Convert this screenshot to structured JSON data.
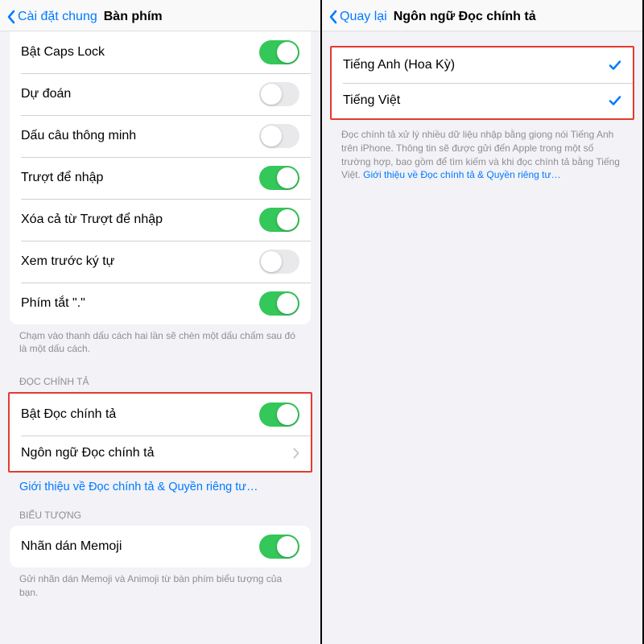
{
  "left": {
    "nav": {
      "back": "Cài đặt chung",
      "title": "Bàn phím"
    },
    "rows": {
      "capslock": "Bật Caps Lock",
      "prediction": "Dự đoán",
      "smart_punctuation": "Dấu câu thông minh",
      "slide_to_type": "Trượt để nhập",
      "delete_slide": "Xóa cả từ Trượt để nhập",
      "char_preview": "Xem trước ký tự",
      "period_shortcut": "Phím tắt \".\""
    },
    "footer1": "Chạm vào thanh dấu cách hai lần sẽ chèn một dấu chấm sau đó là một dấu cách.",
    "section_dictation": "ĐỌC CHÍNH TẢ",
    "dictation_enable": "Bật Đọc chính tả",
    "dictation_langs": "Ngôn ngữ Đọc chính tả",
    "dictation_link": "Giới thiệu về Đọc chính tả & Quyền riêng tư…",
    "section_emoji": "BIỂU TƯỢNG",
    "memoji": "Nhãn dán Memoji",
    "footer2": "Gửi nhãn dán Memoji và Animoji từ bàn phím biểu tượng của bạn."
  },
  "right": {
    "nav": {
      "back": "Quay lại",
      "title": "Ngôn ngữ Đọc chính tả"
    },
    "langs": {
      "en_us": "Tiếng Anh (Hoa Kỳ)",
      "vi": "Tiếng Việt"
    },
    "footer_text": "Đọc chính tả xử lý nhiều dữ liệu nhập bằng giọng nói Tiếng Anh trên iPhone. Thông tin sẽ được gửi đến Apple trong một số trường hợp, bao gồm để tìm kiếm và khi đọc chính tả bằng Tiếng Việt. ",
    "footer_link": "Giới thiệu về Đọc chính tả & Quyền riêng tư…"
  }
}
